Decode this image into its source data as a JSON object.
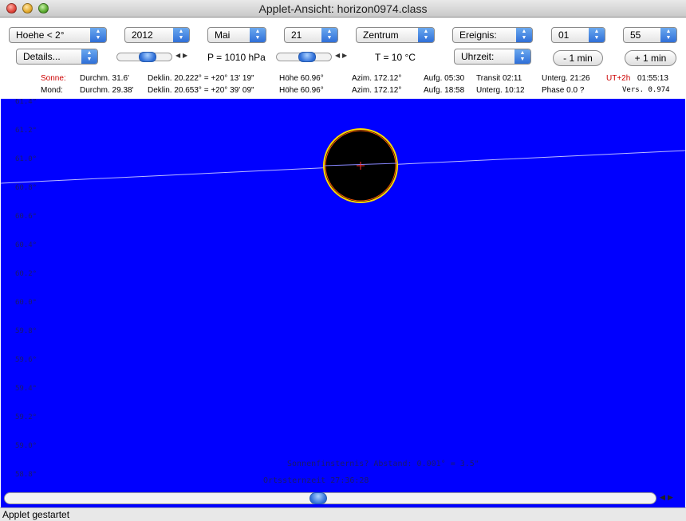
{
  "window": {
    "title": "Applet-Ansicht: horizon0974.class"
  },
  "controls": {
    "hoehe": "Hoehe < 2°",
    "jahr": "2012",
    "monat": "Mai",
    "tag": "21",
    "zentrum": "Zentrum",
    "ereignis": "Ereignis:",
    "stunde": "01",
    "minute": "55",
    "details": "Details...",
    "druck": "P = 1010 hPa",
    "temp": "T = 10 °C",
    "uhrzeit": "Uhrzeit:",
    "minus_min": "- 1 min",
    "plus_min": "+ 1 min"
  },
  "sun": {
    "label": "Sonne:",
    "durchm": "Durchm. 31.6'",
    "deklin": "Deklin. 20.222° = +20° 13' 19\"",
    "hoehe": "Höhe 60.96°",
    "azim": "Azim. 172.12°",
    "aufg": "Aufg. 05:30",
    "transit": "Transit 02:11",
    "unterg": "Unterg. 21:26",
    "utc": "UT+2h",
    "time": "01:55:13"
  },
  "moon": {
    "label": "Mond:",
    "durchm": "Durchm. 29.38'",
    "deklin": "Deklin. 20.653° = +20° 39' 09\"",
    "hoehe": "Höhe 60.96°",
    "azim": "Azim. 172.12°",
    "aufg": "Aufg. 18:58",
    "unterg": "Unterg. 10:12",
    "phase": "Phase 0.0 ?",
    "version": "Vers. 0.974"
  },
  "canvas": {
    "ticks": [
      "61.4°",
      "61.2°",
      "61.0°",
      "60.8°",
      "60.6°",
      "60.4°",
      "60.2°",
      "60.0°",
      "59.8°",
      "59.6°",
      "59.4°",
      "59.2°",
      "59.0°",
      "58.8°"
    ],
    "eclipse_text": "Sonnenfinsternis? Abstand: 0.001° = 3.5\"",
    "sidereal_text": "Ortssternzeit 27:36:28"
  },
  "status": "Applet gestartet"
}
